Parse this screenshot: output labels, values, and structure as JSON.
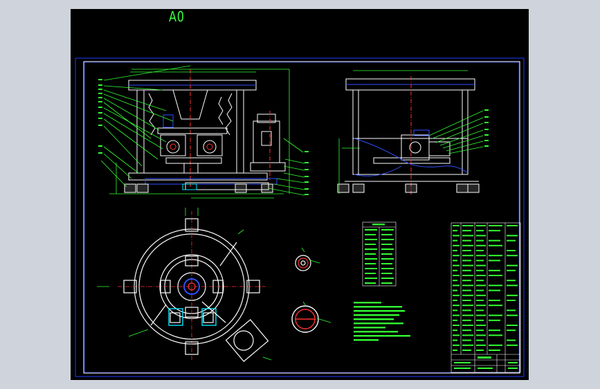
{
  "sheet": {
    "label": "A0"
  },
  "colors": {
    "background": "#000000",
    "outer_bg": "#cfd3db",
    "frame": "#1f3cff",
    "geometry": "#ffffff",
    "dimension": "#33ff33",
    "center_line": "#ff3030",
    "hidden": "#3050ff",
    "highlight": "#00e5ff"
  },
  "views": [
    "front-view",
    "side-view",
    "plan-view",
    "section-a",
    "section-b"
  ],
  "tables": [
    "parts-table",
    "title-block-table"
  ]
}
